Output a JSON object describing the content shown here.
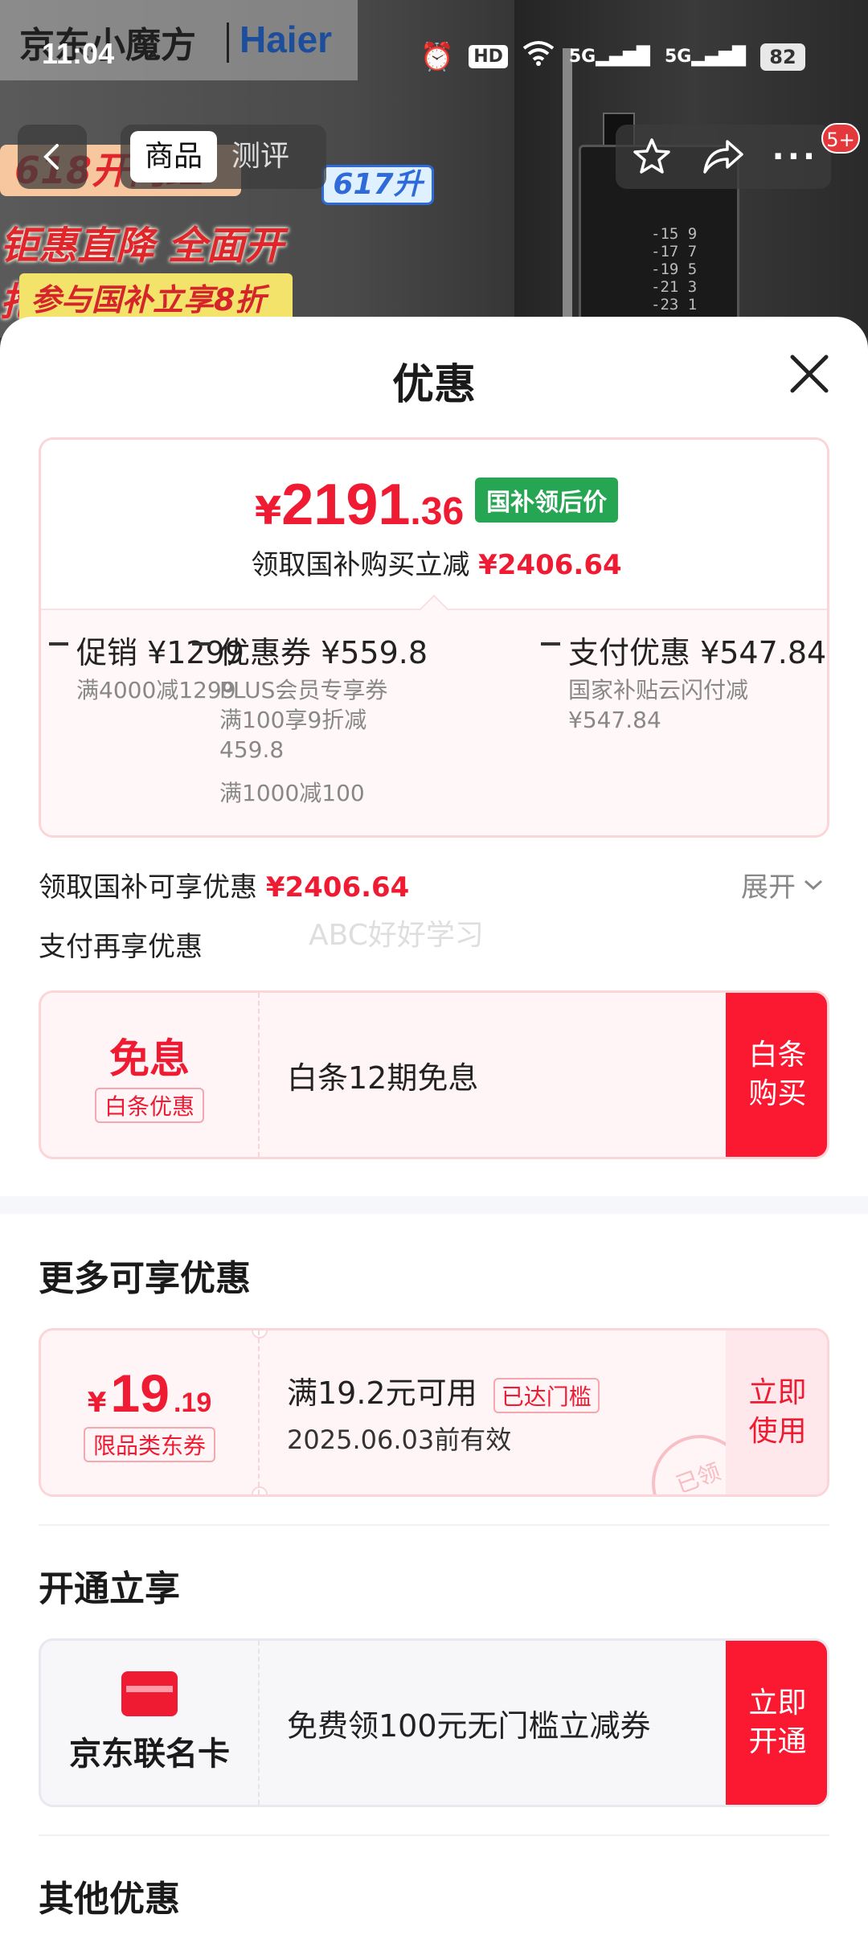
{
  "status_bar": {
    "time": "11:04",
    "hd": "HD",
    "signal1": "5G",
    "signal2": "5G",
    "battery": "82"
  },
  "product_bg": {
    "brand": "京东小魔方",
    "brand2": "Haier",
    "promo_618": "618开门红",
    "promo_line1": "钜惠直降  全面开抢",
    "promo_line2": "参与国补立享8折",
    "volume": "617升",
    "temps": [
      "-15  9",
      "-17  7",
      "-19  5",
      "-21  3",
      "-23  1"
    ]
  },
  "nav": {
    "tabs": [
      {
        "label": "商品",
        "active": true
      },
      {
        "label": "测评",
        "active": false
      }
    ],
    "badge": "5+"
  },
  "sheet": {
    "title": "优惠",
    "price_card": {
      "currency": "¥",
      "price_int": "2191",
      "price_dec": ".36",
      "price_tag": "国补领后价",
      "subtitle": "领取国补购买立减",
      "subtitle_amount": "¥2406.64",
      "columns": [
        {
          "minus": "−",
          "title": "促销 ¥1299",
          "lines": [
            "满4000减1299"
          ],
          "extra": ""
        },
        {
          "minus": "−",
          "title": "优惠券 ¥559.8",
          "lines": [
            "PLUS会员专享券",
            "满100享9折减",
            "459.8"
          ],
          "extra": "满1000减100"
        },
        {
          "minus": "−",
          "title": "支付优惠 ¥547.84",
          "lines": [
            "国家补贴云闪付减",
            "¥547.84"
          ],
          "extra": ""
        }
      ]
    },
    "available_label": "领取国补可享优惠",
    "available_amount": "¥2406.64",
    "expand_label": "展开",
    "pay_more_label": "支付再享优惠",
    "watermark": "ABC好好学习",
    "baitiao": {
      "left_big": "免息",
      "left_tag": "白条优惠",
      "desc": "白条12期免息",
      "button": "白条\n购买"
    },
    "more_section": {
      "title": "更多可享优惠",
      "coupon": {
        "currency": "¥",
        "amount_int": "19",
        "amount_dec": ".19",
        "tag": "限品类东券",
        "condition": "满19.2元可用",
        "reached": "已达门槛",
        "expiry": "2025.06.03前有效",
        "button": "立即\n使用",
        "stamp": "已领"
      }
    },
    "open_section": {
      "title": "开通立享",
      "card_name": "京东联名卡",
      "desc": "免费领100元无门槛立减券",
      "button": "立即\n开通"
    },
    "other_section": {
      "title": "其他优惠"
    }
  }
}
